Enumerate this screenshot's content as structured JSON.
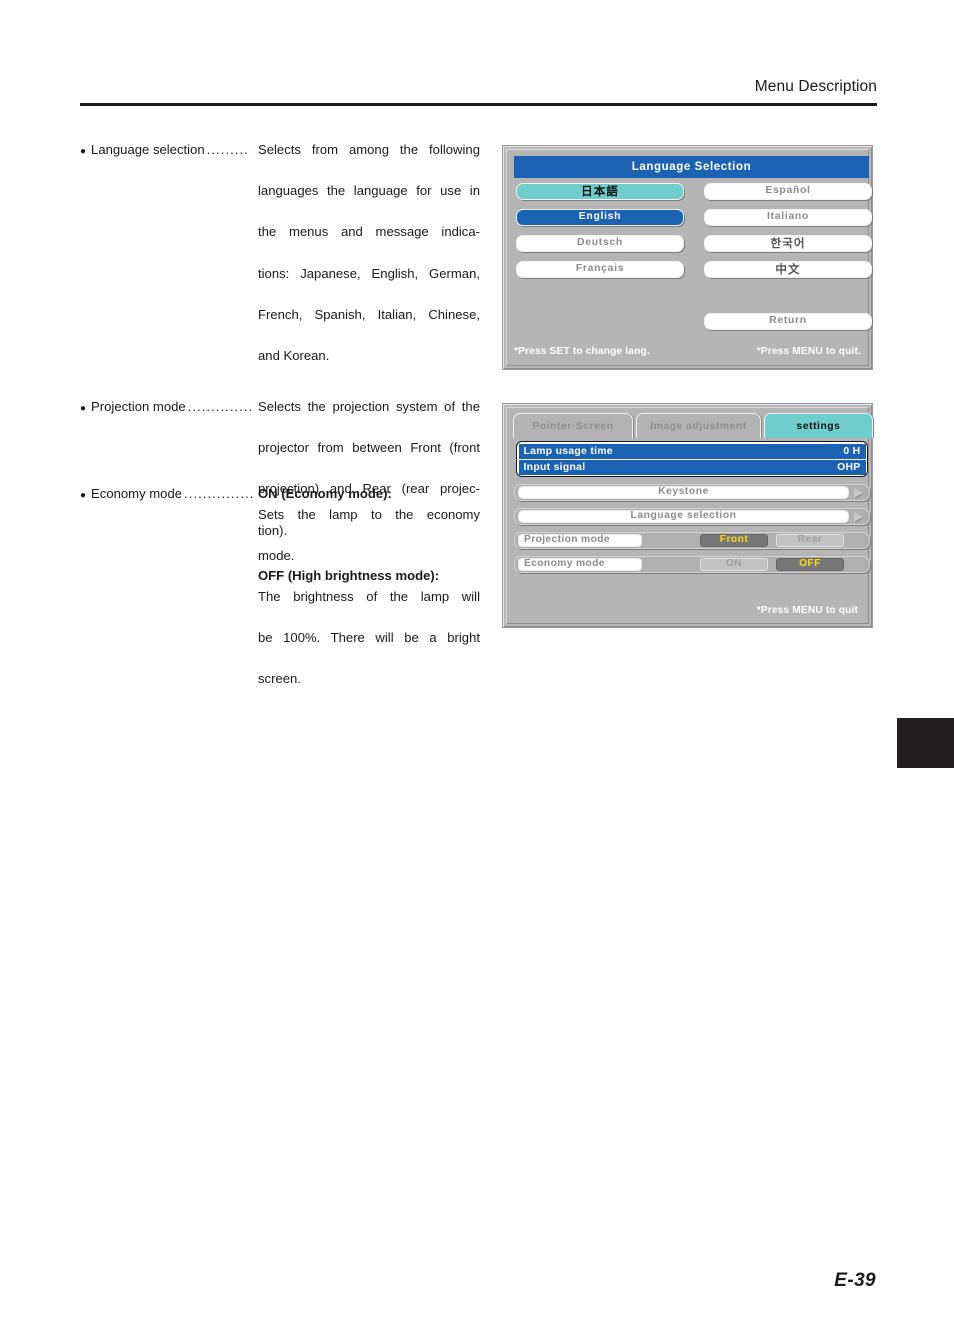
{
  "header": {
    "title": "Menu Description"
  },
  "descriptions": [
    {
      "id": "language",
      "bullet": "●",
      "term": "Language selection",
      "leader": ".........",
      "lines": [
        "Selects from among the following",
        "languages the language for use in",
        "the menus and message indica-",
        "tions: Japanese, English, German,",
        "French, Spanish, Italian, Chinese,",
        "and Korean."
      ]
    },
    {
      "id": "projection",
      "bullet": "●",
      "term": "Projection mode",
      "leader": "..............",
      "lines": [
        "Selects the projection system of the",
        "projector from between Front (front",
        "projection) and Rear (rear projec-",
        "tion)."
      ]
    },
    {
      "id": "economy",
      "bullet": "●",
      "term": "Economy mode",
      "leader": "...............",
      "lines": [
        "ON (Economy mode):",
        "Sets the lamp to the economy",
        "mode.",
        "OFF (High brightness mode):",
        "The brightness of the lamp will",
        "be 100%. There will be a bright",
        "screen."
      ],
      "bold_lines": [
        0,
        3
      ]
    }
  ],
  "osd_language": {
    "title": "Language Selection",
    "buttons": [
      {
        "label": "日本語",
        "state": "cyan",
        "cjk": true,
        "col": "left",
        "row": 0
      },
      {
        "label": "English",
        "state": "blue",
        "cjk": false,
        "col": "left",
        "row": 1
      },
      {
        "label": "Deutsch",
        "state": "normal",
        "cjk": false,
        "col": "left",
        "row": 2
      },
      {
        "label": "Français",
        "state": "normal",
        "cjk": false,
        "col": "left",
        "row": 3
      },
      {
        "label": "Español",
        "state": "normal",
        "cjk": false,
        "col": "right",
        "row": 0
      },
      {
        "label": "Italiano",
        "state": "normal",
        "cjk": false,
        "col": "right",
        "row": 1
      },
      {
        "label": "한국어",
        "state": "normal",
        "cjk": true,
        "col": "right",
        "row": 2
      },
      {
        "label": "中文",
        "state": "normal",
        "cjk": true,
        "col": "right",
        "row": 3
      }
    ],
    "return_label": "Return",
    "footer_left": "*Press SET to change lang.",
    "footer_right": "*Press MENU to quit."
  },
  "osd_settings": {
    "tabs": [
      {
        "label": "Pointer·Screen",
        "active": false
      },
      {
        "label": "Image adjustment",
        "active": false
      },
      {
        "label": "settings",
        "active": true
      }
    ],
    "info_rows": [
      {
        "label": "Lamp usage time",
        "value": "0 H"
      },
      {
        "label": "Input signal",
        "value": "OHP"
      }
    ],
    "submenus": [
      {
        "label": "Keystone"
      },
      {
        "label": "Language selection"
      }
    ],
    "options": [
      {
        "label": "Projection mode",
        "choices": [
          {
            "label": "Front",
            "selected": true
          },
          {
            "label": "Rear",
            "selected": false
          }
        ]
      },
      {
        "label": "Economy mode",
        "choices": [
          {
            "label": "ON",
            "selected": false
          },
          {
            "label": "OFF",
            "selected": true
          }
        ]
      }
    ],
    "footer_right": "*Press MENU to quit"
  },
  "footer": {
    "page_number": "E-39"
  },
  "colors": {
    "osd_background": "#b5b5b5",
    "title_blue": "#1c62b3",
    "accent_cyan": "#6fcdcb",
    "selected_yellow": "#ffd814",
    "selected_gray": "#777777",
    "text_gray": "#8b8b8b",
    "page_tab_black": "#231f20"
  }
}
